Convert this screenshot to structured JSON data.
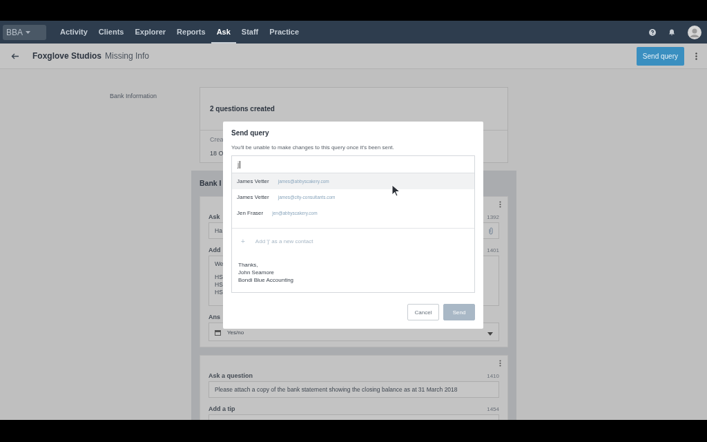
{
  "nav": {
    "org": "BBA",
    "items": [
      {
        "label": "Activity",
        "selected": false
      },
      {
        "label": "Clients",
        "selected": false
      },
      {
        "label": "Explorer",
        "selected": false
      },
      {
        "label": "Reports",
        "selected": false
      },
      {
        "label": "Ask",
        "selected": true
      },
      {
        "label": "Staff",
        "selected": false
      },
      {
        "label": "Practice",
        "selected": false
      }
    ]
  },
  "header": {
    "client": "Foxglove Studios",
    "page": "Missing Info",
    "action": "Send query"
  },
  "section_label": "Bank Information",
  "summary": {
    "title": "2 questions created",
    "created_label": "Crea",
    "created_date": "18 O"
  },
  "panel": {
    "title": "Bank I",
    "cards": [
      {
        "fields": [
          {
            "kind": "input",
            "label": "Ask",
            "count": "1392",
            "value": "Ha",
            "attachment": true
          },
          {
            "kind": "textarea",
            "label": "Add",
            "count": "1401",
            "paragraphs": [
              [
                "We"
              ],
              [
                "HS",
                "HS",
                "HS"
              ]
            ]
          },
          {
            "kind": "select",
            "label": "Ans",
            "value": "Yes/no"
          }
        ]
      },
      {
        "fields": [
          {
            "kind": "input",
            "label": "Ask a question",
            "count": "1410",
            "value": "Please attach a copy of the bank statement showing the closing balance as at 31 March 2018"
          },
          {
            "kind": "input",
            "label": "Add a tip",
            "count": "1454"
          }
        ]
      }
    ]
  },
  "modal": {
    "title": "Send query",
    "note": "You'll be unable to make changes to this query once it's been sent.",
    "search_value": "j",
    "contacts": [
      {
        "name": "James Vetter",
        "email": "james@abbyscakery.com",
        "selected": true
      },
      {
        "name": "James Vetter",
        "email": "james@city-consultants.com",
        "selected": false
      },
      {
        "name": "Jen Fraser",
        "email": "jen@abbyscakery.com",
        "selected": false
      }
    ],
    "add_icon": "+",
    "add_contact": "Add 'j' as a new contact",
    "signature": [
      "Thanks,",
      "John Seamore",
      "Bondi Blue Accounting"
    ],
    "buttons": [
      {
        "label": "Cancel",
        "disabled": false
      },
      {
        "label": "Send",
        "disabled": true
      }
    ]
  }
}
